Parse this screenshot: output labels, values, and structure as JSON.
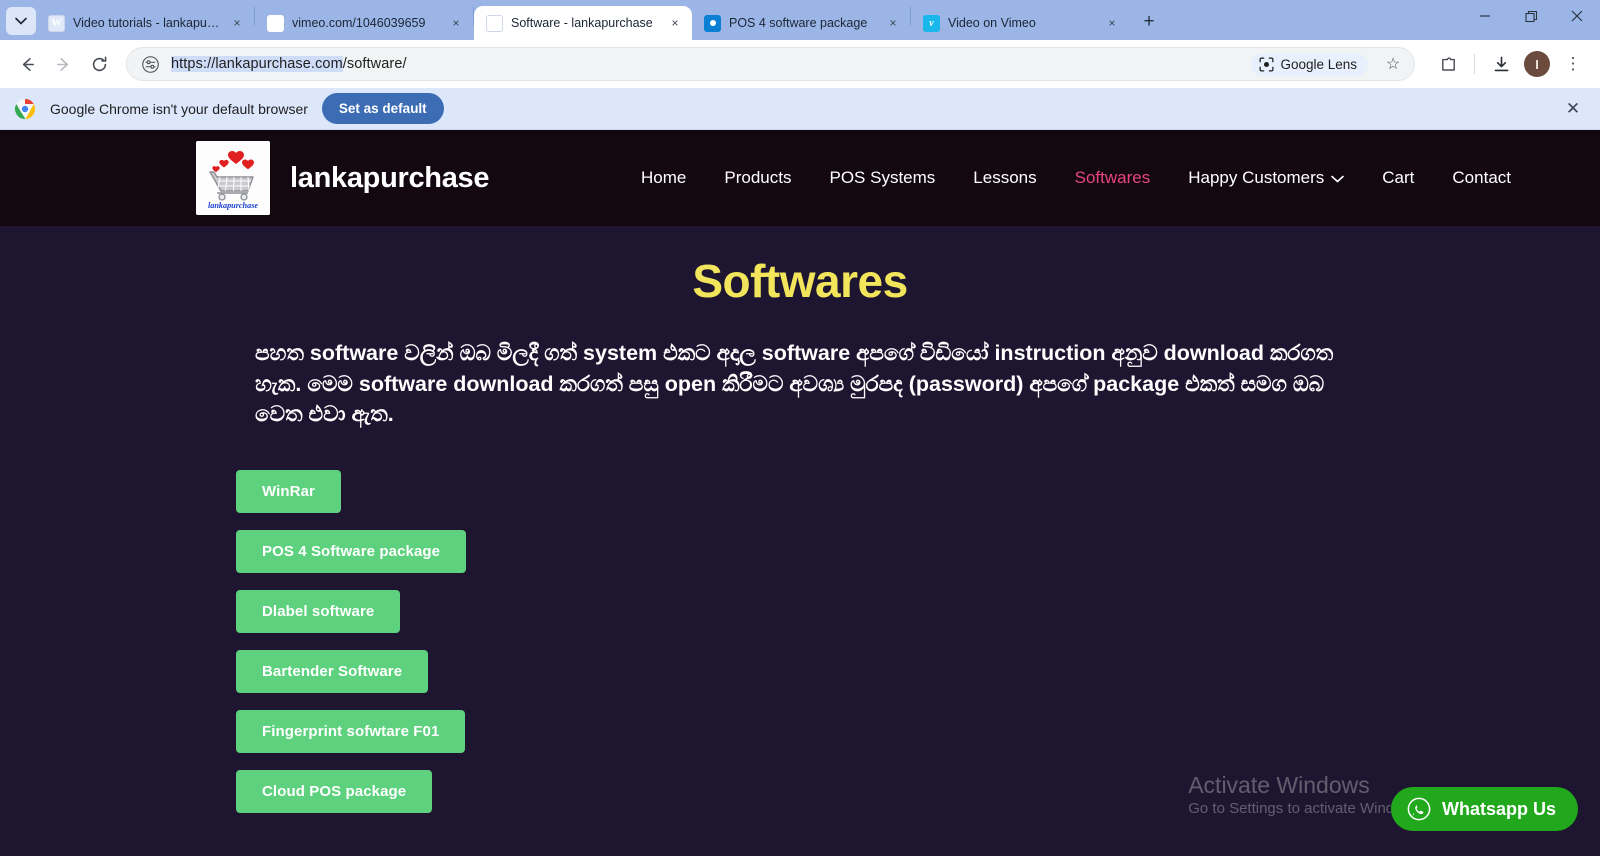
{
  "browser": {
    "tabs": [
      {
        "title": "Video tutorials - lankapurchase",
        "favicon": "wordpress-icon",
        "active": false
      },
      {
        "title": "vimeo.com/1046039659",
        "favicon": "vimeo-round-icon",
        "active": false
      },
      {
        "title": "Software - lankapurchase",
        "favicon": "wordpress-icon",
        "active": true
      },
      {
        "title": "POS 4 software package",
        "favicon": "pos-icon",
        "active": false
      },
      {
        "title": "Video on Vimeo",
        "favicon": "vimeo-icon",
        "active": false
      }
    ],
    "new_tab_label": "+",
    "close_label": "×",
    "window_controls": {
      "minimize": "—",
      "restore": "❐",
      "close": "✕"
    },
    "toolbar": {
      "back_label": "←",
      "forward_label": "→",
      "reload_label": "⟳",
      "url_selected": "https://lankapurchase.com",
      "url_rest": "/software/",
      "url_full": "https://lankapurchase.com/software/",
      "lens_label": "Google Lens",
      "bookmark_label": "☆",
      "extensions_label": "extensions-icon",
      "downloads_label": "downloads-icon",
      "profile_initial": "I",
      "menu_label": "⋮"
    },
    "infobar": {
      "message": "Google Chrome isn't your default browser",
      "button_label": "Set as default",
      "close_label": "✕"
    }
  },
  "site": {
    "brand_name": "lankapurchase",
    "logo_caption": "lankapurchase",
    "nav": [
      {
        "label": "Home",
        "current": false,
        "dropdown": false
      },
      {
        "label": "Products",
        "current": false,
        "dropdown": false
      },
      {
        "label": "POS Systems",
        "current": false,
        "dropdown": false
      },
      {
        "label": "Lessons",
        "current": false,
        "dropdown": false
      },
      {
        "label": "Softwares",
        "current": true,
        "dropdown": false
      },
      {
        "label": "Happy Customers",
        "current": false,
        "dropdown": true
      },
      {
        "label": "Cart",
        "current": false,
        "dropdown": false
      },
      {
        "label": "Contact",
        "current": false,
        "dropdown": false
      }
    ],
    "page_title": "Softwares",
    "intro_paragraph": "පහත software වලින් ඔබ මිලදී ගත් system එකට අදාල software අපගේ විඩියෝ instruction අනුව download කරගත හැක. මෙම software download කරගත් පසු open කිරීමට අවශ්‍ය මුරපද (password) අපගේ package එකත් සමග ඔබ වෙත එවා ඇත.",
    "download_buttons": [
      {
        "label": "WinRar"
      },
      {
        "label": "POS 4 Software package"
      },
      {
        "label": "Dlabel software"
      },
      {
        "label": "Bartender Software"
      },
      {
        "label": "Fingerprint sofwtare F01"
      },
      {
        "label": "Cloud POS package"
      }
    ],
    "whatsapp_label": "Whatsapp Us"
  },
  "watermark": {
    "line1": "Activate Windows",
    "line2": "Go to Settings to activate Windows."
  },
  "colors": {
    "accent_pink": "#e8457c",
    "title_yellow": "#f2e55c",
    "button_green": "#5ed17e",
    "whatsapp_green": "#22a81c",
    "header_bg": "#140810",
    "page_bg": "#1e1630"
  }
}
